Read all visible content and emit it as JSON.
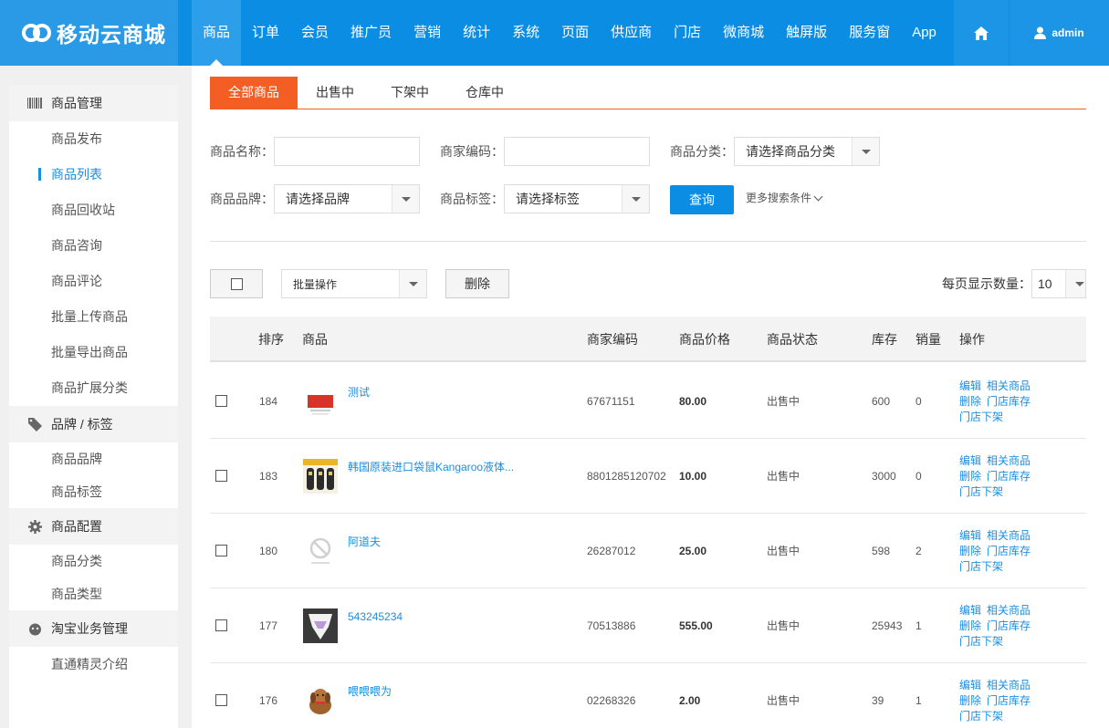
{
  "app": {
    "logo_text": "移动云商城",
    "user": "admin"
  },
  "nav": [
    "商品",
    "订单",
    "会员",
    "推广员",
    "营销",
    "统计",
    "系统",
    "页面",
    "供应商",
    "门店",
    "微商城",
    "触屏版",
    "服务窗",
    "App"
  ],
  "sidebar": {
    "groups": [
      {
        "label": "商品管理",
        "icon": "barcode-icon",
        "items": [
          "商品发布",
          "商品列表",
          "商品回收站",
          "商品咨询",
          "商品评论",
          "批量上传商品",
          "批量导出商品",
          "商品扩展分类"
        ]
      },
      {
        "label": "品牌 / 标签",
        "icon": "tag-icon",
        "items": [
          "商品品牌",
          "商品标签"
        ]
      },
      {
        "label": "商品配置",
        "icon": "gear-icon",
        "items": [
          "商品分类",
          "商品类型"
        ]
      },
      {
        "label": "淘宝业务管理",
        "icon": "taobao-icon",
        "items": [
          "直通精灵介绍"
        ]
      }
    ],
    "active_item": "商品列表"
  },
  "tabs": [
    "全部商品",
    "出售中",
    "下架中",
    "仓库中"
  ],
  "filters": {
    "name_label": "商品名称：",
    "code_label": "商家编码：",
    "category_label": "商品分类：",
    "category_value": "请选择商品分类",
    "brand_label": "商品品牌：",
    "brand_value": "请选择品牌",
    "tag_label": "商品标签：",
    "tag_value": "请选择标签",
    "query_button": "查询",
    "more": "更多搜索条件"
  },
  "toolbar": {
    "batch_value": "批量操作",
    "delete_button": "删除",
    "pagesize_label": "每页显示数量：",
    "pagesize_value": "10"
  },
  "table": {
    "headers": [
      "排序",
      "商品",
      "商家编码",
      "商品价格",
      "商品状态",
      "库存",
      "销量",
      "操作"
    ],
    "ops": [
      "编辑",
      "相关商品",
      "删除",
      "门店库存",
      "门店下架"
    ],
    "rows": [
      {
        "sort": "184",
        "name": "测试",
        "code": "67671151",
        "price": "80.00",
        "status": "出售中",
        "stock": "600",
        "sales": "0"
      },
      {
        "sort": "183",
        "name": "韩国原装进口袋鼠Kangaroo液体...",
        "code": "8801285120702",
        "price": "10.00",
        "status": "出售中",
        "stock": "3000",
        "sales": "0"
      },
      {
        "sort": "180",
        "name": "阿道夫",
        "code": "26287012",
        "price": "25.00",
        "status": "出售中",
        "stock": "598",
        "sales": "2"
      },
      {
        "sort": "177",
        "name": "543245234",
        "code": "70513886",
        "price": "555.00",
        "status": "出售中",
        "stock": "25943",
        "sales": "1"
      },
      {
        "sort": "176",
        "name": "喂喂喂为",
        "code": "02268326",
        "price": "2.00",
        "status": "出售中",
        "stock": "39",
        "sales": "1"
      }
    ]
  }
}
